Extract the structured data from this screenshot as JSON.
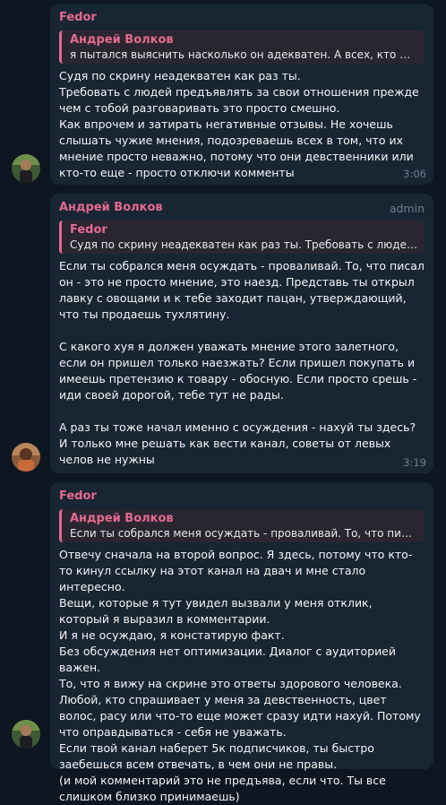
{
  "messages": [
    {
      "sender": "Fedor",
      "admin_label": "",
      "reply": {
        "name": "Андрей Волков",
        "text": "я пытался выяснить насколько он адекватен. А всех, кто прос..."
      },
      "lines": [
        "Судя по скрину неадекватен как раз ты.",
        "Требовать с людей предъявлять за свои отношения прежде чем с тобой разговаривать это просто смешно.",
        "Как впрочем и затирать негативные отзывы. Не хочешь слышать чужие мнения, подозреваешь всех в том, что их мнение просто неважно, потому что они девственники или кто-то еще - просто отключи комменты"
      ],
      "time": "3:06"
    },
    {
      "sender": "Андрей Волков",
      "admin_label": "admin",
      "reply": {
        "name": "Fedor",
        "text": "Судя по скрину неадекватен как раз ты. Требовать с людей п..."
      },
      "lines": [
        "Если ты собрался меня осуждать - проваливай. То, что писал он - это не просто мнение, это наезд. Представь ты открыл лавку с овощами и к тебе заходит пацан, утверждающий, что ты продаешь тухлятину.",
        "",
        "С какого хуя я должен уважать мнение этого залетного, если он пришел только наезжать? Если пришел покупать и имеешь претензию к товару - обосную. Если просто срешь - иди своей дорогой, тебе тут не рады.",
        "",
        "А раз ты тоже начал именно с осуждения - нахуй ты здесь? И только мне решать как вести канал, советы от левых челов не нужны"
      ],
      "time": "3:19"
    },
    {
      "sender": "Fedor",
      "admin_label": "",
      "reply": {
        "name": "Андрей Волков",
        "text": "Если ты собрался меня осуждать - проваливай. То, что писал ..."
      },
      "lines": [
        "Отвечу сначала на второй вопрос. Я здесь, потому что кто-то кинул ссылку на этот канал на двач и мне стало интересно.",
        "Вещи, которые я тут увидел вызвали у меня отклик, который я выразил в комментарии.",
        "И я не осуждаю, я констатирую факт.",
        "Без обсуждения нет оптимизации. Диалог с аудиторией важен.",
        "То, что я вижу на скрине это ответы здорового человека. Любой, кто спрашивает у меня за девственность, цвет волос, расу или что-то еще может сразу идти нахуй. Потому что оправдываться - себя не уважать.",
        "Если твой канал наберет 5к подписчиков, ты быстро заебешься всем отвечать, в чем они не правы.",
        "(и мой комментарий это не предъява, если что. Ты все слишком близко принимаешь)"
      ],
      "time": ""
    }
  ]
}
